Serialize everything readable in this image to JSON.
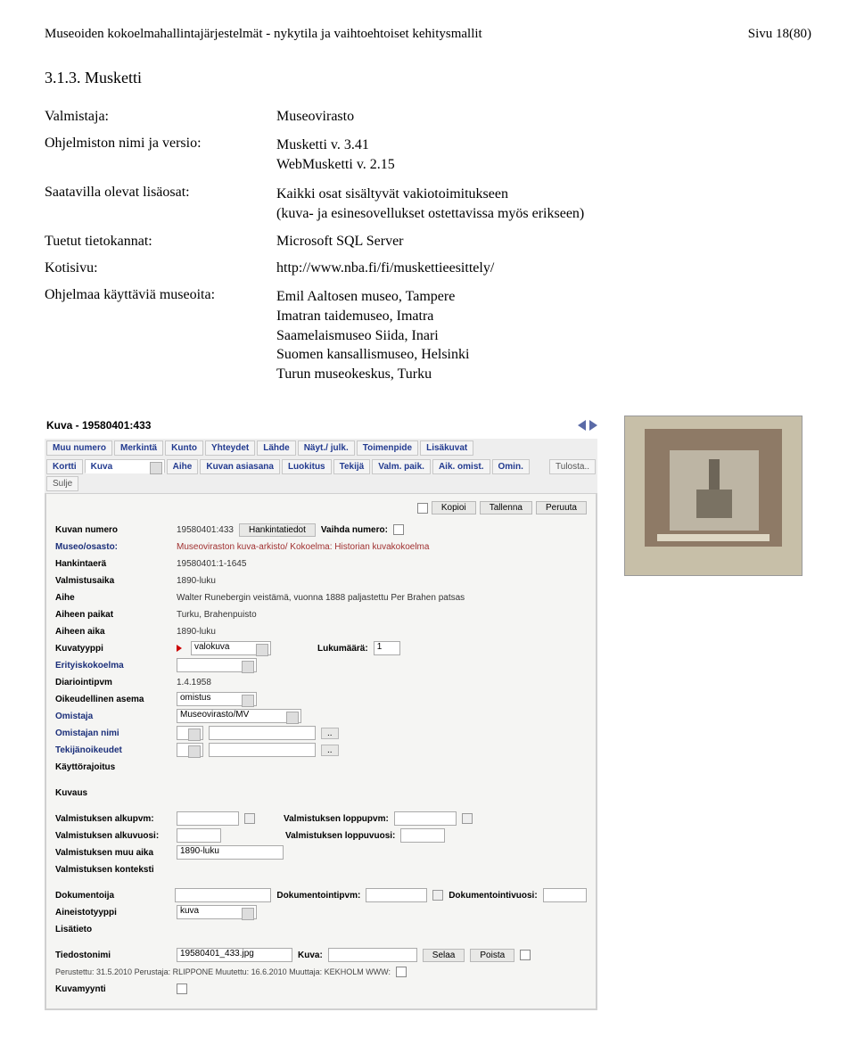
{
  "header": {
    "left": "Museoiden kokoelmahallintajärjestelmät - nykytila ja vaihtoehtoiset kehitysmallit",
    "right": "Sivu 18(80)"
  },
  "section": "3.1.3. Musketti",
  "rows": {
    "valmistaja": {
      "k": "Valmistaja:",
      "v": "Museovirasto"
    },
    "versio": {
      "k": "Ohjelmiston nimi ja versio:",
      "v1": "Musketti v. 3.41",
      "v2": "WebMusketti v. 2.15"
    },
    "lisaosat": {
      "k": "Saatavilla olevat lisäosat:",
      "v1": "Kaikki osat sisältyvät vakiotoimitukseen",
      "v2": "(kuva- ja esinesovellukset ostettavissa myös erikseen)"
    },
    "tietokannat": {
      "k": "Tuetut tietokannat:",
      "v": "Microsoft SQL Server"
    },
    "kotisivu": {
      "k": "Kotisivu:",
      "v": "http://www.nba.fi/fi/muskettieesittely/"
    },
    "museot": {
      "k": "Ohjelmaa käyttäviä museoita:",
      "v1": "Emil Aaltosen museo, Tampere",
      "v2": "Imatran taidemuseo, Imatra",
      "v3": "Saamelaismuseo Siida, Inari",
      "v4": "Suomen kansallismuseo, Helsinki",
      "v5": "Turun museokeskus, Turku"
    }
  },
  "shot": {
    "title": "Kuva - 19580401:433",
    "tabs1": [
      "Muu numero",
      "Merkintä",
      "Kunto",
      "Yhteydet",
      "Lähde",
      "Näyt./ julk.",
      "Toimenpide",
      "Lisäkuvat"
    ],
    "tabs2": [
      "Kortti",
      "Kuva",
      "Aihe",
      "Kuvan asiasana",
      "Luokitus",
      "Tekijä",
      "Valm. paik.",
      "Aik. omist.",
      "Omin."
    ],
    "tabs2_right": [
      "Tulosta..",
      "Sulje"
    ],
    "btns": {
      "kopioi": "Kopioi",
      "tallenna": "Tallenna",
      "peruuta": "Peruuta",
      "hankinta": "Hankintatiedot",
      "vaihda": "Vaihda numero:",
      "selaa": "Selaa",
      "poista": "Poista"
    },
    "f": {
      "kuvan_numero": "Kuvan numero",
      "kuvan_numero_v": "19580401:433",
      "museo": "Museo/osasto:",
      "museo_v": "Museoviraston kuva-arkisto/ Kokoelma: Historian kuvakokoelma",
      "hankintaera": "Hankintaerä",
      "hankintaera_v": "19580401:1-1645",
      "valmistusaika": "Valmistusaika",
      "valmistusaika_v": "1890-luku",
      "aihe": "Aihe",
      "aihe_v": "Walter Runebergin veistämä, vuonna 1888 paljastettu Per Brahen patsas",
      "aiheen_paikat": "Aiheen paikat",
      "aiheen_paikat_v": "Turku, Brahenpuisto",
      "aiheen_aika": "Aiheen aika",
      "aiheen_aika_v": "1890-luku",
      "kuvatyyppi": "Kuvatyyppi",
      "kuvatyyppi_v": "valokuva",
      "lukumaara": "Lukumäärä:",
      "lukumaara_v": "1",
      "erityiskokoelma": "Erityiskokoelma",
      "diariointipvm": "Diariointipvm",
      "diariointipvm_v": "1.4.1958",
      "oikeudellinen": "Oikeudellinen asema",
      "oikeudellinen_v": "omistus",
      "omistaja": "Omistaja",
      "omistaja_v": "Museovirasto/MV",
      "omistajan_nimi": "Omistajan nimi",
      "tekijanoikeudet": "Tekijänoikeudet",
      "kayttorajoitus": "Käyttörajoitus",
      "kuvaus": "Kuvaus",
      "valku": "Valmistuksen alkupvm:",
      "vlopp": "Valmistuksen loppupvm:",
      "valkuv": "Valmistuksen alkuvuosi:",
      "vloppv": "Valmistuksen loppuvuosi:",
      "vmuu": "Valmistuksen muu aika",
      "vmuu_v": "1890-luku",
      "vkont": "Valmistuksen konteksti",
      "dokija": "Dokumentoija",
      "dokpvm": "Dokumentointipvm:",
      "dokv": "Dokumentointivuosi:",
      "aineisto": "Aineistotyyppi",
      "aineisto_v": "kuva",
      "lisatieto": "Lisätieto",
      "tiedostonimi": "Tiedostonimi",
      "tiedostonimi_v": "19580401_433.jpg",
      "kuva_lbl": "Kuva:",
      "perustettu": "Perustettu: 31.5.2010 Perustaja: RLIPPONE Muutettu: 16.6.2010 Muuttaja: KEKHOLM WWW:",
      "kuvamyynti": "Kuvamyynti"
    }
  }
}
